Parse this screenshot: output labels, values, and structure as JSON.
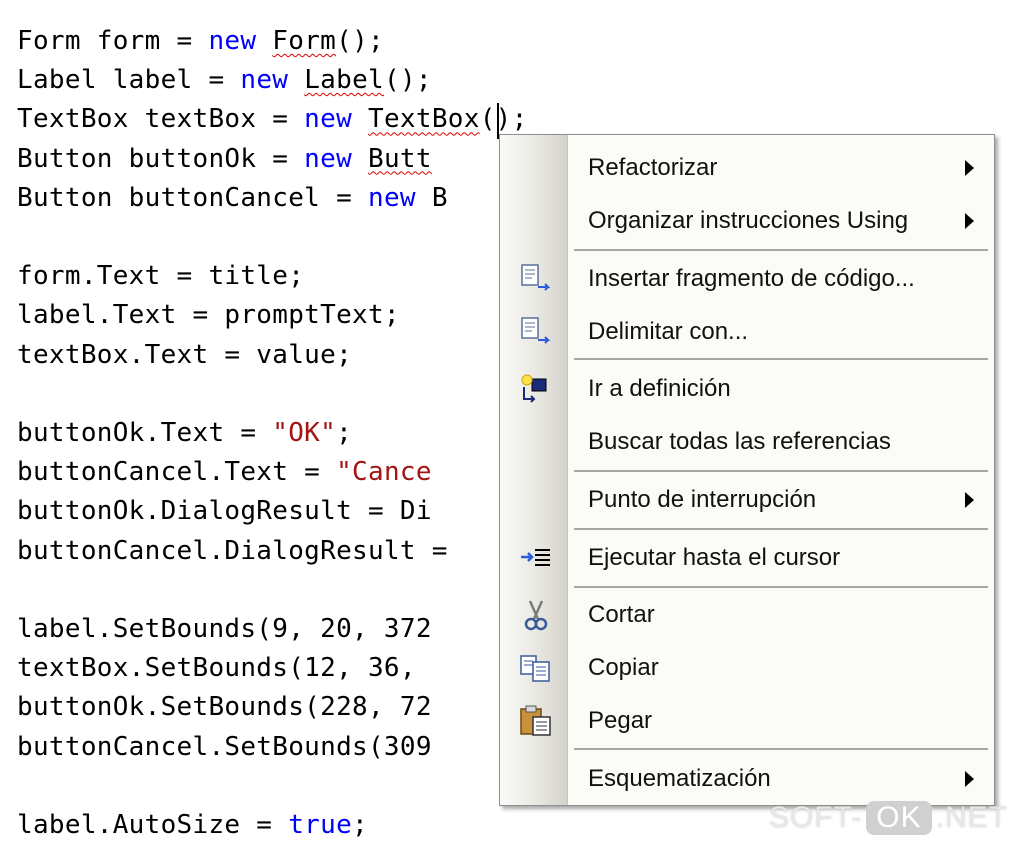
{
  "editor": {
    "lines": [
      {
        "id": 1,
        "tokens": [
          {
            "t": "Form form = "
          },
          {
            "t": "new",
            "c": "kw"
          },
          {
            "t": " "
          },
          {
            "t": "Form",
            "c": "sq"
          },
          {
            "t": "();"
          }
        ]
      },
      {
        "id": 2,
        "tokens": [
          {
            "t": "Label label = "
          },
          {
            "t": "new",
            "c": "kw"
          },
          {
            "t": " "
          },
          {
            "t": "Label",
            "c": "sq"
          },
          {
            "t": "();"
          }
        ]
      },
      {
        "id": 3,
        "tokens": [
          {
            "t": "TextBox textBox = "
          },
          {
            "t": "new",
            "c": "kw"
          },
          {
            "t": " "
          },
          {
            "t": "TextBox",
            "c": "sq"
          },
          {
            "t": "();"
          }
        ]
      },
      {
        "id": 4,
        "tokens": [
          {
            "t": "Button buttonOk = "
          },
          {
            "t": "new",
            "c": "kw"
          },
          {
            "t": " "
          },
          {
            "t": "Butt",
            "c": "sq"
          }
        ]
      },
      {
        "id": 5,
        "tokens": [
          {
            "t": "Button buttonCancel = "
          },
          {
            "t": "new",
            "c": "kw"
          },
          {
            "t": " B"
          }
        ]
      },
      {
        "id": 6,
        "tokens": []
      },
      {
        "id": 7,
        "tokens": [
          {
            "t": "form.Text = title;"
          }
        ]
      },
      {
        "id": 8,
        "tokens": [
          {
            "t": "label.Text = promptText;"
          }
        ]
      },
      {
        "id": 9,
        "tokens": [
          {
            "t": "textBox.Text = value;"
          }
        ]
      },
      {
        "id": 10,
        "tokens": []
      },
      {
        "id": 11,
        "tokens": [
          {
            "t": "buttonOk.Text = "
          },
          {
            "t": "\"OK\"",
            "c": "str"
          },
          {
            "t": ";"
          }
        ]
      },
      {
        "id": 12,
        "tokens": [
          {
            "t": "buttonCancel.Text = "
          },
          {
            "t": "\"Cance",
            "c": "str"
          }
        ]
      },
      {
        "id": 13,
        "tokens": [
          {
            "t": "buttonOk.DialogResult = Di"
          }
        ]
      },
      {
        "id": 14,
        "tokens": [
          {
            "t": "buttonCancel.DialogResult ="
          }
        ]
      },
      {
        "id": 15,
        "tokens": []
      },
      {
        "id": 16,
        "tokens": [
          {
            "t": "label.SetBounds(9, 20, 372"
          }
        ]
      },
      {
        "id": 17,
        "tokens": [
          {
            "t": "textBox.SetBounds(12, 36, "
          }
        ]
      },
      {
        "id": 18,
        "tokens": [
          {
            "t": "buttonOk.SetBounds(228, 72"
          }
        ]
      },
      {
        "id": 19,
        "tokens": [
          {
            "t": "buttonCancel.SetBounds(309"
          }
        ]
      },
      {
        "id": 20,
        "tokens": []
      },
      {
        "id": 21,
        "tokens": [
          {
            "t": "label.AutoSize = "
          },
          {
            "t": "true",
            "c": "kw"
          },
          {
            "t": ";"
          }
        ]
      }
    ],
    "colors": {
      "keyword": "#0000ff",
      "string": "#a31515",
      "text": "#000000",
      "squiggle": "#e00000"
    }
  },
  "context_menu": {
    "items": [
      {
        "label": "Refactorizar",
        "icon": "",
        "submenu": true
      },
      {
        "label": "Organizar instrucciones Using",
        "icon": "",
        "submenu": true
      },
      {
        "separator": true
      },
      {
        "label": "Insertar fragmento de código...",
        "icon": "insert-snippet-icon",
        "submenu": false
      },
      {
        "label": "Delimitar con...",
        "icon": "surround-with-icon",
        "submenu": false
      },
      {
        "separator": true
      },
      {
        "label": "Ir a definición",
        "icon": "go-to-definition-icon",
        "submenu": false
      },
      {
        "label": "Buscar todas las referencias",
        "icon": "",
        "submenu": false
      },
      {
        "separator": true
      },
      {
        "label": "Punto de interrupción",
        "icon": "",
        "submenu": true
      },
      {
        "separator": true
      },
      {
        "label": "Ejecutar hasta el cursor",
        "icon": "run-to-cursor-icon",
        "submenu": false
      },
      {
        "separator": true
      },
      {
        "label": "Cortar",
        "icon": "cut-icon",
        "submenu": false
      },
      {
        "label": "Copiar",
        "icon": "copy-icon",
        "submenu": false
      },
      {
        "label": "Pegar",
        "icon": "paste-icon",
        "submenu": false
      },
      {
        "separator": true
      },
      {
        "label": "Esquematización",
        "icon": "",
        "submenu": true
      }
    ]
  },
  "watermark": {
    "left": "SOFT-",
    "box": "OK",
    "right": ".NET"
  }
}
